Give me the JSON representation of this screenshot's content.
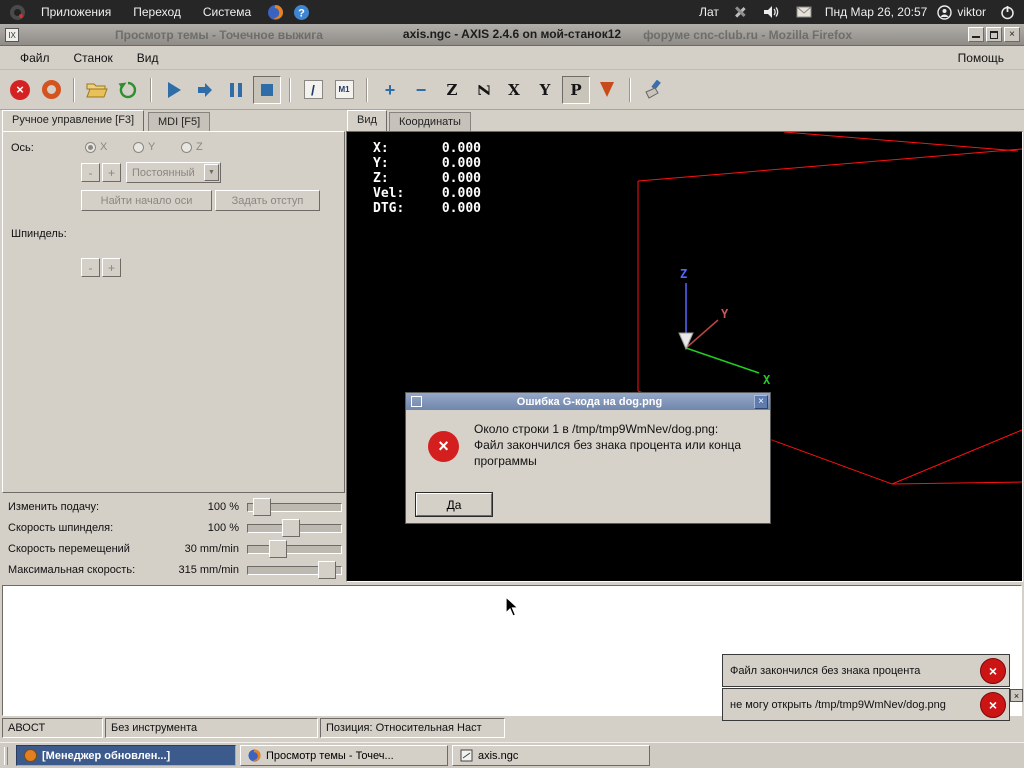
{
  "desktop": {
    "menus": [
      {
        "label": "Приложения"
      },
      {
        "label": "Переход"
      },
      {
        "label": "Система"
      }
    ],
    "keyboard_layout": "Лат",
    "clock": "Пнд Мар 26, 20:57",
    "user": "viktor"
  },
  "window": {
    "title": "axis.ngc - AXIS 2.4.6 on мой-станок12",
    "bg_title_left": "Просмотр темы - Точечное выжига",
    "bg_title_right": "форуме cnc-club.ru - Mozilla Firefox",
    "menus": [
      {
        "label": "Файл"
      },
      {
        "label": "Станок"
      },
      {
        "label": "Вид"
      }
    ],
    "help_menu": "Помощь"
  },
  "toolbar": {
    "skip": "/",
    "optional_pause": "M1",
    "view_letters": {
      "top": "Z",
      "rotated_top": "Z",
      "side": "X",
      "front": "Y",
      "perspective": "P"
    }
  },
  "left_panel": {
    "tabs": [
      {
        "label": "Ручное управление [F3]"
      },
      {
        "label": "MDI [F5]"
      }
    ],
    "axis_label": "Ось:",
    "axes": [
      {
        "label": "X"
      },
      {
        "label": "Y"
      },
      {
        "label": "Z"
      }
    ],
    "jog_minus": "-",
    "jog_plus": "+",
    "increment_value": "Постоянный",
    "home_button": "Найти начало оси",
    "touchoff_button": "Задать отступ",
    "spindle_label": "Шпиндель:",
    "spindle_minus": "-",
    "spindle_plus": "+",
    "sliders": [
      {
        "label": "Изменить подачу:",
        "value": "100 %",
        "pos": 8
      },
      {
        "label": "Скорость шпинделя:",
        "value": "100 %",
        "pos": 45
      },
      {
        "label": "Скорость перемещений",
        "value": "30 mm/min",
        "pos": 28
      },
      {
        "label": "Максимальная скорость:",
        "value": "315 mm/min",
        "pos": 92
      }
    ]
  },
  "preview": {
    "tabs": [
      {
        "label": "Вид"
      },
      {
        "label": "Координаты"
      }
    ],
    "readout": [
      {
        "label": "X:",
        "value": "0.000"
      },
      {
        "label": "Y:",
        "value": "0.000"
      },
      {
        "label": "Z:",
        "value": "0.000"
      },
      {
        "label": "Vel:",
        "value": "0.000"
      },
      {
        "label": "DTG:",
        "value": "0.000"
      }
    ],
    "axis_labels": {
      "x": "X",
      "y": "Y",
      "z": "Z"
    }
  },
  "dialog": {
    "title": "Ошибка G-кода на dog.png",
    "message_line1": "Около строки 1 в /tmp/tmp9WmNev/dog.png:",
    "message_line2": "Файл закончился без знака процента или конца программы",
    "ok_button": "Да"
  },
  "notifications": [
    {
      "text": "Файл закончился без знака процента"
    },
    {
      "text": "не могу открыть /tmp/tmp9WmNev/dog.png"
    }
  ],
  "statusbar": [
    {
      "text": "АВОСТ"
    },
    {
      "text": "Без инструмента"
    },
    {
      "text": "Позиция: Относительная Наст"
    }
  ],
  "taskbar": [
    {
      "label": "[Менеджер обновлен...]"
    },
    {
      "label": "Просмотр темы - Точеч..."
    },
    {
      "label": "axis.ngc"
    }
  ],
  "icons": {
    "close": "×",
    "error_x": "×",
    "dropdown_arrow": "▼",
    "zoom_in": "+",
    "zoom_out": "−",
    "help_question": "?"
  },
  "colors": {
    "wireframe": "#ff1010",
    "axis_x": "#22cc22",
    "axis_y": "#bb4444",
    "axis_z": "#5566ff",
    "error_red": "#cc1414",
    "taskbar_active": "#3c5a8c"
  }
}
